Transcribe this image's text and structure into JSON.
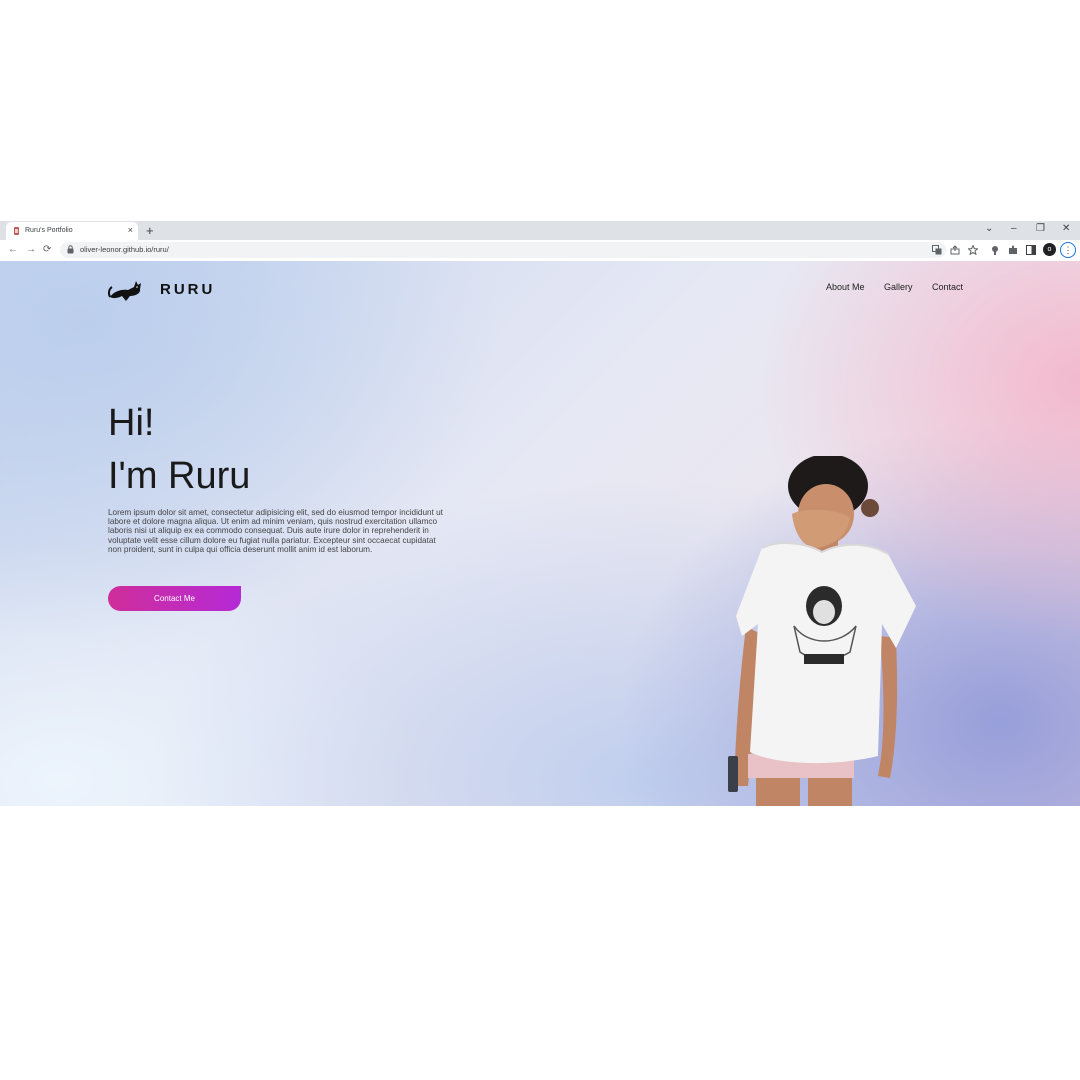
{
  "browser": {
    "tab_title": "Ruru's Portfolio",
    "tab_close": "×",
    "new_tab": "+",
    "url": "oliver-leonor.github.io/ruru/",
    "profile_initial": "o",
    "window_controls": {
      "dropdown": "⌄",
      "minimize": "–",
      "restore": "❐",
      "close": "✕"
    },
    "nav": {
      "back": "←",
      "forward": "→",
      "reload": "⟳"
    },
    "toolbar_icons": [
      "translate-icon",
      "share-icon",
      "star-icon",
      "extension-pin-icon",
      "puzzle-icon",
      "sidepanel-icon"
    ]
  },
  "site": {
    "brand": "RURU",
    "nav": {
      "about": "About Me",
      "gallery": "Gallery",
      "contact": "Contact"
    },
    "hero": {
      "line1": "Hi!",
      "line2": "I'm Ruru",
      "body": "Lorem ipsum dolor sit amet, consectetur adipisicing elit, sed do eiusmod tempor incididunt ut labore et dolore magna aliqua. Ut enim ad minim veniam, quis nostrud exercitation ullamco laboris nisi ut aliquip ex ea commodo consequat. Duis aute irure dolor in reprehenderit in voluptate velit esse cillum dolore eu fugiat nulla pariatur. Excepteur sint occaecat cupidatat non proident, sunt in culpa qui officia deserunt mollit anim id est laborum.",
      "cta": "Contact Me"
    },
    "colors": {
      "cta_start": "#cf2e9a",
      "cta_end": "#b52ad6"
    }
  }
}
